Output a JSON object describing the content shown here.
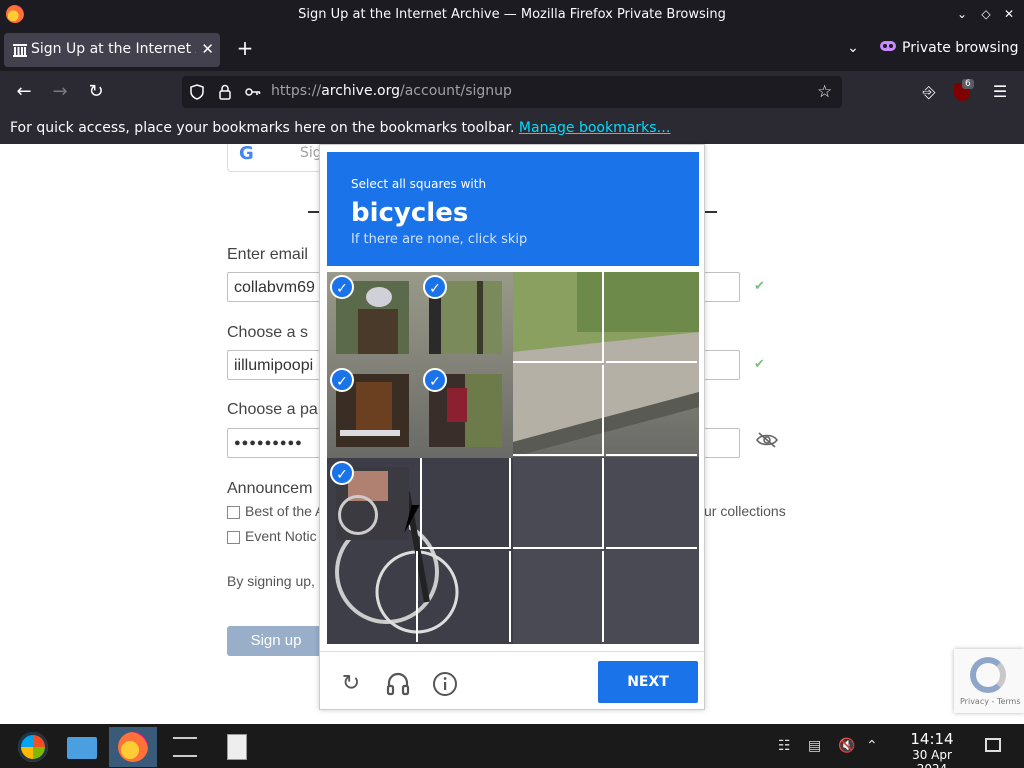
{
  "window": {
    "title": "Sign Up at the Internet Archive — Mozilla Firefox Private Browsing"
  },
  "tabs": [
    {
      "label": "Sign Up at the Internet Archive",
      "icon": "archive-building-icon"
    }
  ],
  "toolbar": {
    "private_label": "Private browsing",
    "url_prefix": "https://",
    "url_domain": "archive.org",
    "url_path": "/account/signup",
    "ublock_count": "6"
  },
  "bookmarks_bar": {
    "message": "For quick access, place your bookmarks here on the bookmarks toolbar.",
    "link": "Manage bookmarks…"
  },
  "signup_page": {
    "google_label": "Sig",
    "email_label": "Enter email",
    "email_value": "collabvm69",
    "screenname_label": "Choose a s",
    "screenname_value": "iillumipoopi",
    "password_label": "Choose a pa",
    "password_value": "●●●●●●●●●",
    "announcements_label": "Announcem",
    "opt1": "Best of the A",
    "opt2": "Event Notic",
    "collections_text": "ur collections",
    "byline": "By signing up, y",
    "signup_button": "Sign up",
    "recaptcha_links": "Privacy - Terms"
  },
  "captcha": {
    "instruction": "Select all squares with",
    "target": "bicycles",
    "hint": "If there are none, click skip",
    "selected_tiles": [
      0,
      1,
      4,
      5,
      8
    ],
    "next_button": "NEXT"
  },
  "taskbar": {
    "time": "14:14",
    "date": "30 Apr 2024"
  }
}
